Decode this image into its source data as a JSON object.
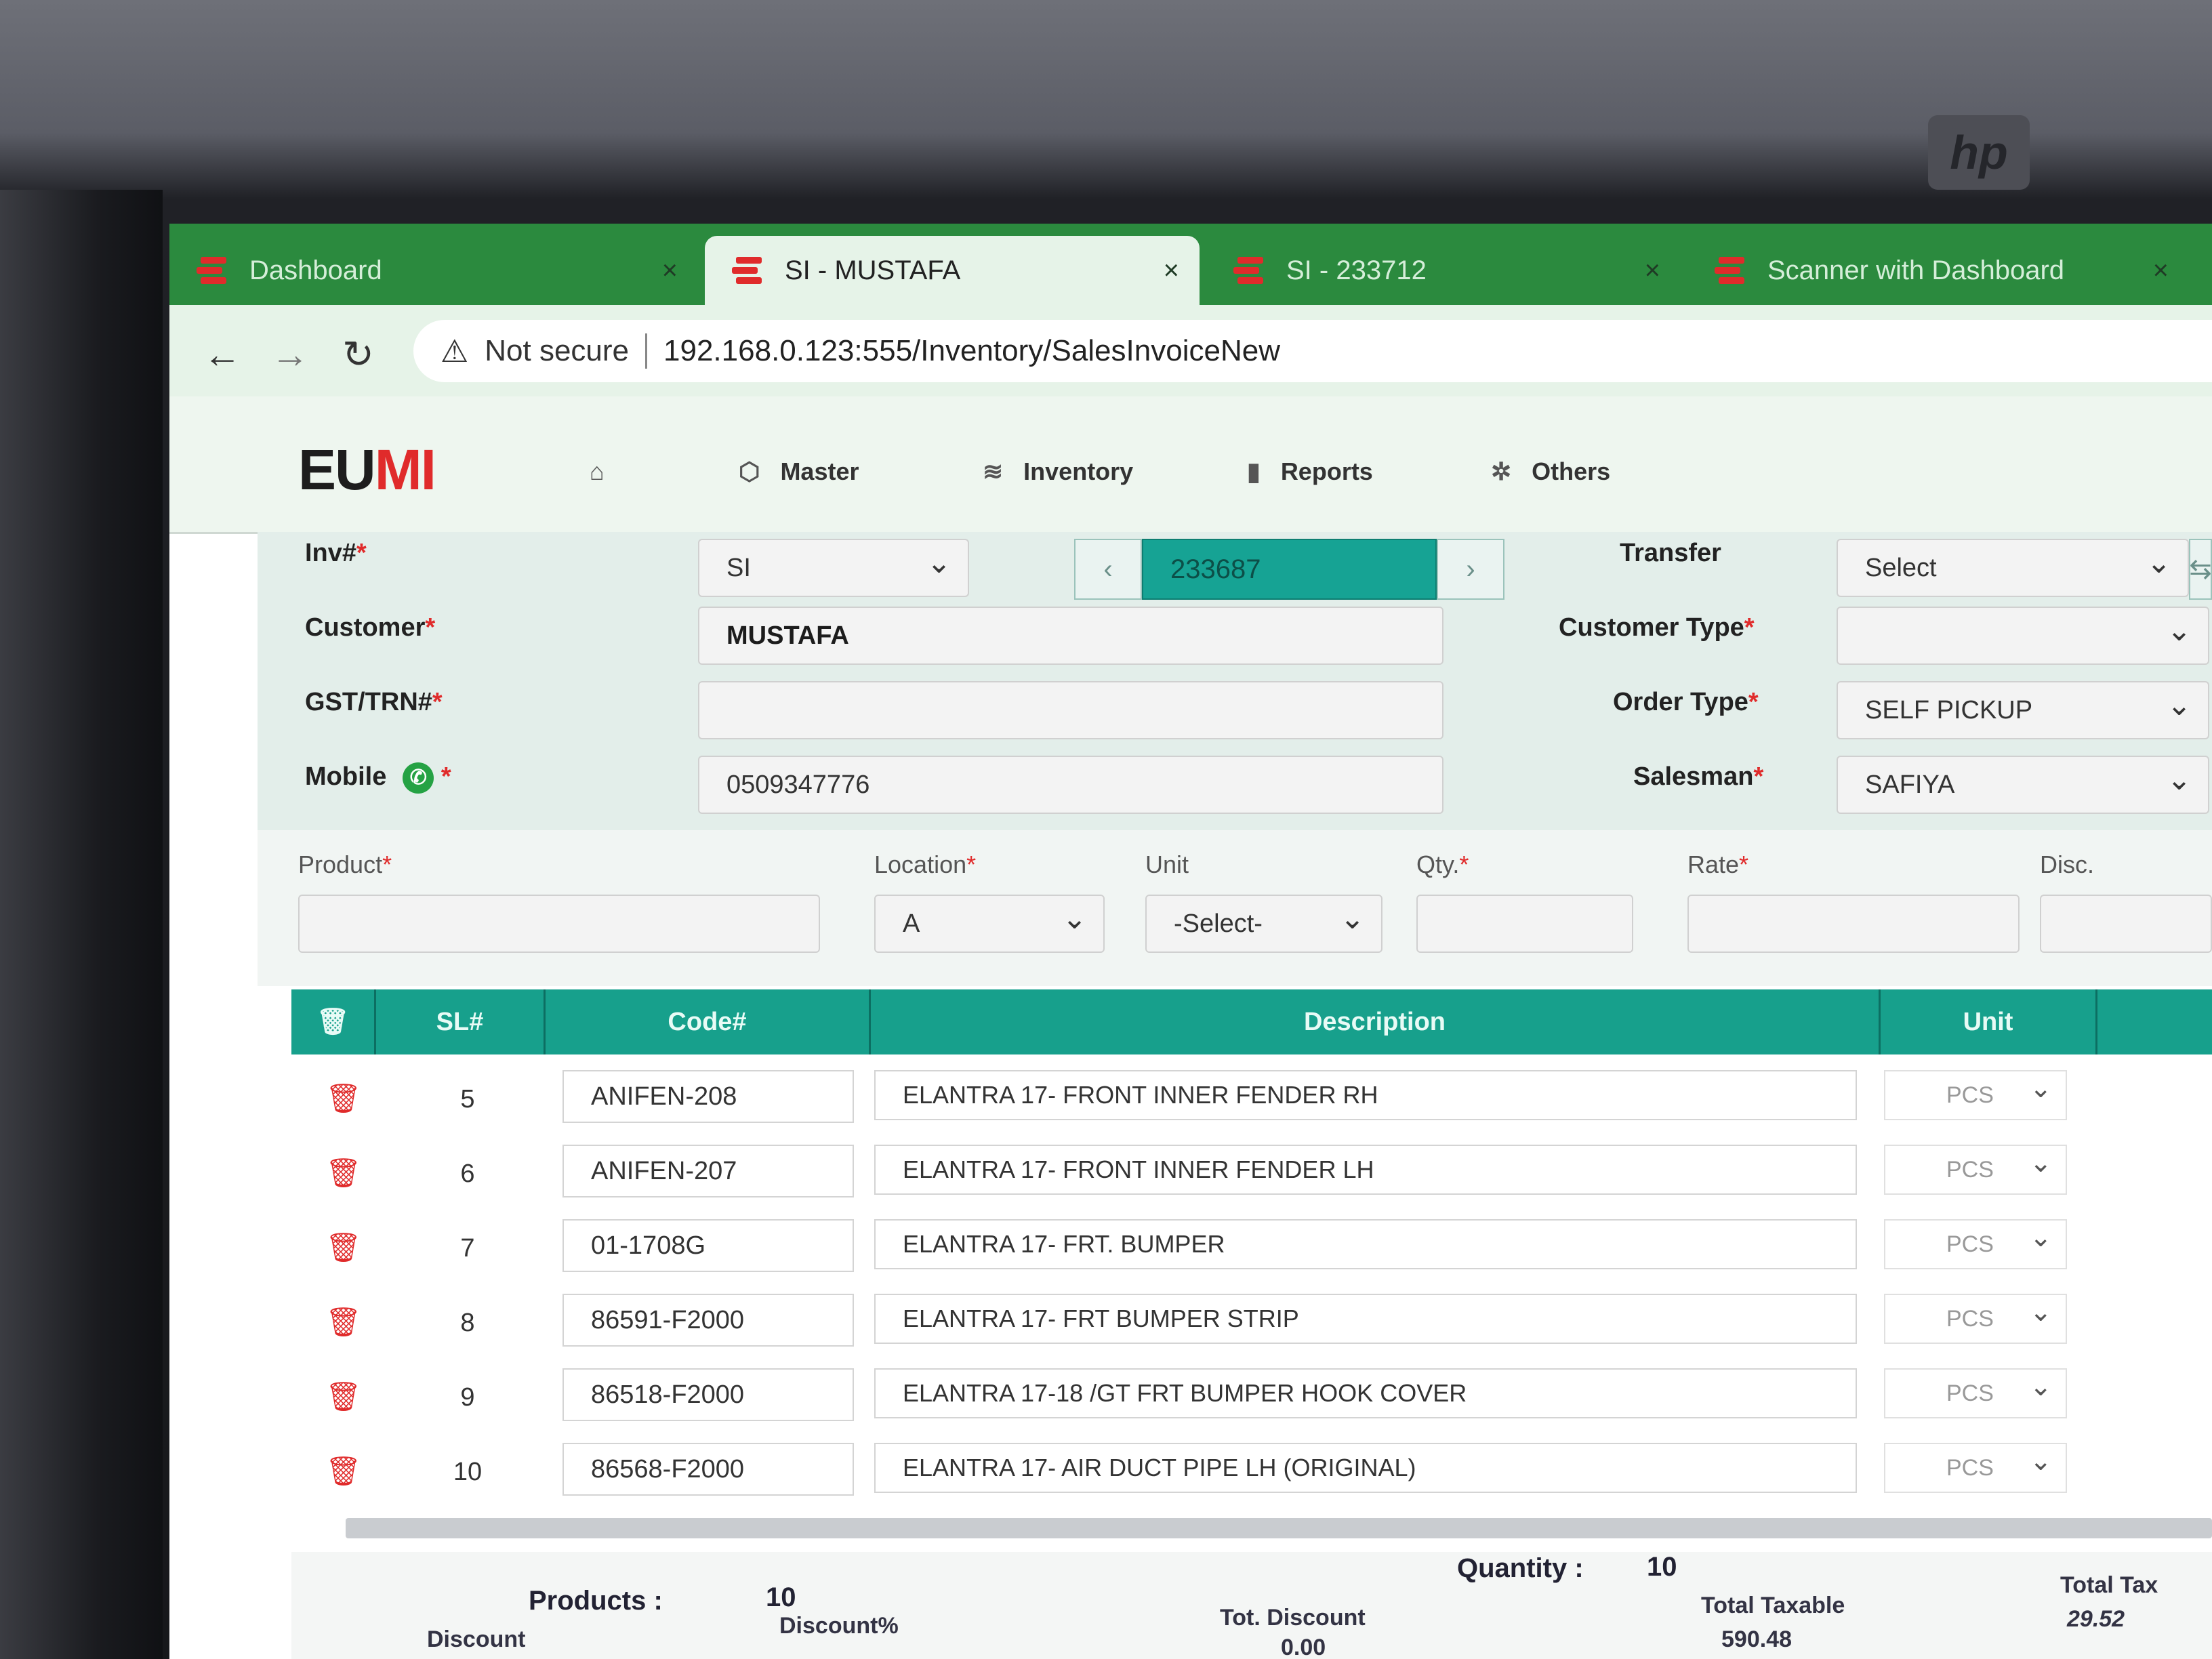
{
  "tabs": [
    {
      "label": "Dashboard"
    },
    {
      "label": "SI - MUSTAFA"
    },
    {
      "label": "SI - 233712"
    },
    {
      "label": "Scanner with Dashboard"
    }
  ],
  "tab_close": "×",
  "address": {
    "security": "Not secure",
    "url": "192.168.0.123:555/Inventory/SalesInvoiceNew"
  },
  "brand": {
    "logo_a": "EU",
    "logo_b": "MI",
    "monitor": "hp"
  },
  "menu": {
    "master": "Master",
    "inventory": "Inventory",
    "reports": "Reports",
    "others": "Others"
  },
  "form": {
    "inv_label": "Inv#",
    "inv_prefix": "SI",
    "inv_number": "233687",
    "customer_label": "Customer",
    "customer_value": "MUSTAFA",
    "gst_label": "GST/TRN#",
    "gst_value": "",
    "mobile_label": "Mobile",
    "mobile_value": "0509347776",
    "transfer_label": "Transfer",
    "transfer_value": "Select",
    "customer_type_label": "Customer Type",
    "customer_type_value": "",
    "order_type_label": "Order Type",
    "order_type_value": "SELF PICKUP",
    "salesman_label": "Salesman",
    "salesman_value": "SAFIYA",
    "required_mark": "*"
  },
  "entry": {
    "product_label": "Product",
    "location_label": "Location",
    "location_value": "A",
    "unit_label": "Unit",
    "unit_value": "-Select-",
    "qty_label": "Qty.",
    "rate_label": "Rate",
    "disc_label": "Disc."
  },
  "table": {
    "headers": {
      "sl": "SL#",
      "code": "Code#",
      "description": "Description",
      "unit": "Unit"
    },
    "rows": [
      {
        "sl": "5",
        "code": "ANIFEN-208",
        "description": "ELANTRA 17- FRONT INNER FENDER RH",
        "unit": "PCS"
      },
      {
        "sl": "6",
        "code": "ANIFEN-207",
        "description": "ELANTRA 17- FRONT INNER FENDER LH",
        "unit": "PCS"
      },
      {
        "sl": "7",
        "code": "01-1708G",
        "description": "ELANTRA 17- FRT. BUMPER",
        "unit": "PCS"
      },
      {
        "sl": "8",
        "code": "86591-F2000",
        "description": "ELANTRA 17- FRT BUMPER STRIP",
        "unit": "PCS"
      },
      {
        "sl": "9",
        "code": "86518-F2000",
        "description": "ELANTRA 17-18 /GT FRT BUMPER HOOK COVER",
        "unit": "PCS"
      },
      {
        "sl": "10",
        "code": "86568-F2000",
        "description": "ELANTRA 17- AIR DUCT PIPE LH (ORIGINAL)",
        "unit": "PCS"
      }
    ]
  },
  "footer": {
    "products_label": "Products :",
    "products_value": "10",
    "quantity_label": "Quantity :",
    "quantity_value": "10",
    "discount_label": "Discount",
    "discount_pct_label": "Discount%",
    "tot_discount_label": "Tot. Discount",
    "tot_discount_value": "0.00",
    "total_taxable_label": "Total Taxable",
    "total_taxable_value": "590.48",
    "total_tax_label": "Total Tax",
    "total_tax_value": "29.52"
  },
  "colors": {
    "accent": "#17a08c",
    "tabbar": "#2b8a3e",
    "danger": "#e02b2b"
  }
}
